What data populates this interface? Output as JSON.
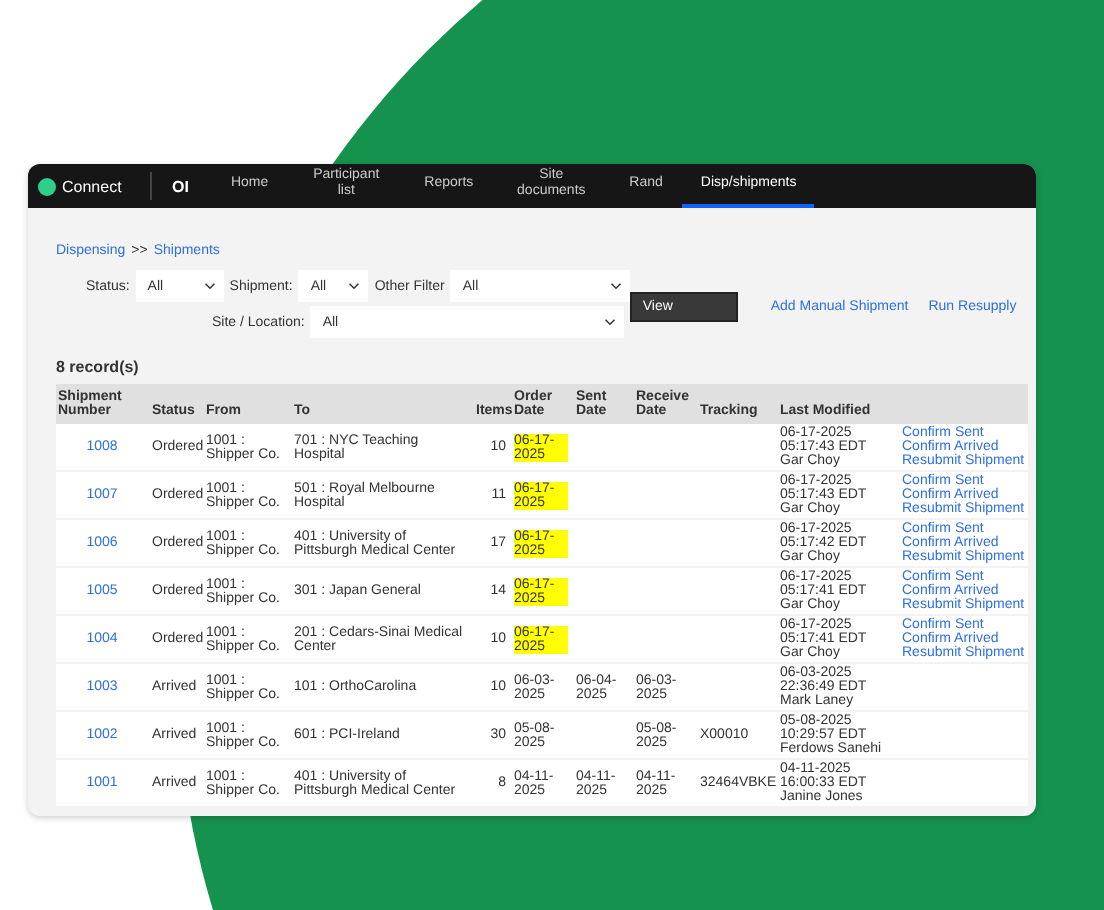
{
  "nav": {
    "logo": "Connect",
    "app": "OI",
    "tabs": [
      {
        "label": "Home",
        "selected": false
      },
      {
        "label": "Participant list",
        "selected": false
      },
      {
        "label": "Reports",
        "selected": false
      },
      {
        "label": "Site documents",
        "selected": false
      },
      {
        "label": "Rand",
        "selected": false
      },
      {
        "label": "Disp/shipments",
        "selected": true
      }
    ]
  },
  "breadcrumb": [
    "Dispensing",
    "Shipments"
  ],
  "breadcrumb_separator": ">>",
  "filters": {
    "status": {
      "label": "Status:",
      "value": "All"
    },
    "shipment": {
      "label": "Shipment:",
      "value": "All"
    },
    "other": {
      "label": "Other Filter",
      "value": "All"
    },
    "site": {
      "label": "Site / Location:",
      "value": "All"
    },
    "view_button": "View",
    "links": [
      "Add Manual Shipment",
      "Run Resupply"
    ]
  },
  "record_count": "8 record(s)",
  "table": {
    "columns": [
      "Shipment Number",
      "Status",
      "From",
      "To",
      "Items",
      "Order Date",
      "Sent Date",
      "Receive Date",
      "Tracking",
      "Last Modified"
    ],
    "rows": [
      {
        "number": "1008",
        "status": "Ordered",
        "from": "1001 : Shipper Co.",
        "to": "701 : NYC Teaching Hospital",
        "items": "10",
        "order_date": "06-17-2025",
        "order_highlighted": true,
        "sent_date": "",
        "receive_date": "",
        "tracking": "",
        "last_modified": [
          "06-17-2025",
          "05:17:43 EDT",
          "Gar Choy"
        ],
        "actions": [
          "Confirm Sent",
          "Confirm Arrived",
          "Resubmit Shipment"
        ]
      },
      {
        "number": "1007",
        "status": "Ordered",
        "from": "1001 : Shipper Co.",
        "to": "501 : Royal Melbourne Hospital",
        "items": "11",
        "order_date": "06-17-2025",
        "order_highlighted": true,
        "sent_date": "",
        "receive_date": "",
        "tracking": "",
        "last_modified": [
          "06-17-2025",
          "05:17:43 EDT",
          "Gar Choy"
        ],
        "actions": [
          "Confirm Sent",
          "Confirm Arrived",
          "Resubmit Shipment"
        ]
      },
      {
        "number": "1006",
        "status": "Ordered",
        "from": "1001 : Shipper Co.",
        "to": "401 : University of Pittsburgh Medical Center",
        "items": "17",
        "order_date": "06-17-2025",
        "order_highlighted": true,
        "sent_date": "",
        "receive_date": "",
        "tracking": "",
        "last_modified": [
          "06-17-2025",
          "05:17:42 EDT",
          "Gar Choy"
        ],
        "actions": [
          "Confirm Sent",
          "Confirm Arrived",
          "Resubmit Shipment"
        ]
      },
      {
        "number": "1005",
        "status": "Ordered",
        "from": "1001 : Shipper Co.",
        "to": "301 : Japan General",
        "items": "14",
        "order_date": "06-17-2025",
        "order_highlighted": true,
        "sent_date": "",
        "receive_date": "",
        "tracking": "",
        "last_modified": [
          "06-17-2025",
          "05:17:41 EDT",
          "Gar Choy"
        ],
        "actions": [
          "Confirm Sent",
          "Confirm Arrived",
          "Resubmit Shipment"
        ]
      },
      {
        "number": "1004",
        "status": "Ordered",
        "from": "1001 : Shipper Co.",
        "to": "201 : Cedars-Sinai Medical Center",
        "items": "10",
        "order_date": "06-17-2025",
        "order_highlighted": true,
        "sent_date": "",
        "receive_date": "",
        "tracking": "",
        "last_modified": [
          "06-17-2025",
          "05:17:41 EDT",
          "Gar Choy"
        ],
        "actions": [
          "Confirm Sent",
          "Confirm Arrived",
          "Resubmit Shipment"
        ]
      },
      {
        "number": "1003",
        "status": "Arrived",
        "from": "1001 : Shipper Co.",
        "to": "101 : OrthoCarolina",
        "items": "10",
        "order_date": "06-03-2025",
        "order_highlighted": false,
        "sent_date": "06-04-2025",
        "receive_date": "06-03-2025",
        "tracking": "",
        "last_modified": [
          "06-03-2025",
          "22:36:49 EDT",
          "Mark Laney"
        ],
        "actions": []
      },
      {
        "number": "1002",
        "status": "Arrived",
        "from": "1001 : Shipper Co.",
        "to": "601 : PCI-Ireland",
        "items": "30",
        "order_date": "05-08-2025",
        "order_highlighted": false,
        "sent_date": "",
        "receive_date": "05-08-2025",
        "tracking": "X00010",
        "last_modified": [
          "05-08-2025",
          "10:29:57 EDT",
          "Ferdows Sanehi"
        ],
        "actions": []
      },
      {
        "number": "1001",
        "status": "Arrived",
        "from": "1001 : Shipper Co.",
        "to": "401 : University of Pittsburgh Medical Center",
        "items": "8",
        "order_date": "04-11-2025",
        "order_highlighted": false,
        "sent_date": "04-11-2025",
        "receive_date": "04-11-2025",
        "tracking": "32464VBKE",
        "last_modified": [
          "04-11-2025",
          "16:00:33 EDT",
          "Janine Jones"
        ],
        "actions": []
      }
    ]
  }
}
